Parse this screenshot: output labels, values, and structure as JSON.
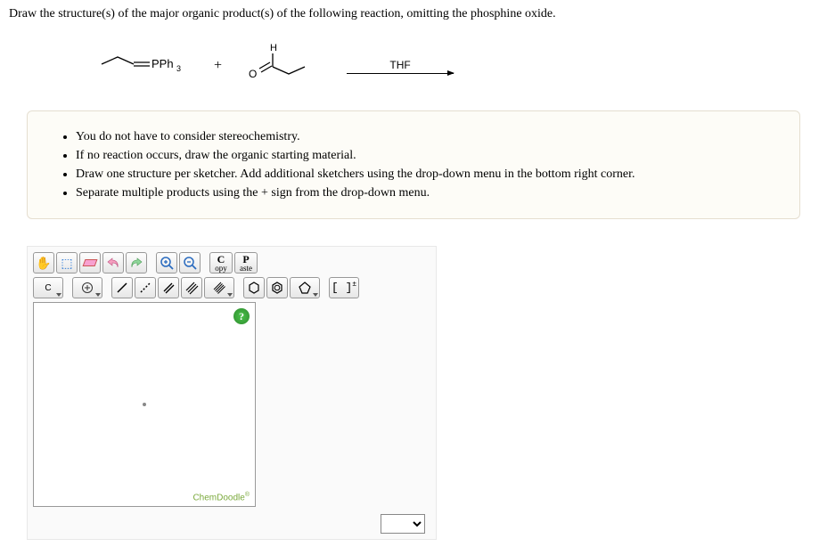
{
  "question": "Draw the structure(s) of the major organic product(s) of the following reaction, omitting the phosphine oxide.",
  "reaction": {
    "reagent1_label": "=PPh",
    "reagent1_sub": "3",
    "plus": "+",
    "h_label": "H",
    "o_label": "O",
    "solvent": "THF"
  },
  "instructions": {
    "items": [
      "You do not have to consider stereochemistry.",
      "If no reaction occurs, draw the organic starting material.",
      "Draw one structure per sketcher. Add additional sketchers using the drop-down menu in the bottom right corner.",
      "Separate multiple products using the + sign from the drop-down menu."
    ]
  },
  "toolbar": {
    "copy_big": "C",
    "copy_small": "opy",
    "paste_big": "P",
    "paste_small": "aste",
    "element_c": "C",
    "brackets": "[ ]",
    "brackets_charge": "±"
  },
  "canvas": {
    "help": "?",
    "brand": "ChemDoodle",
    "brand_mark": "®"
  }
}
